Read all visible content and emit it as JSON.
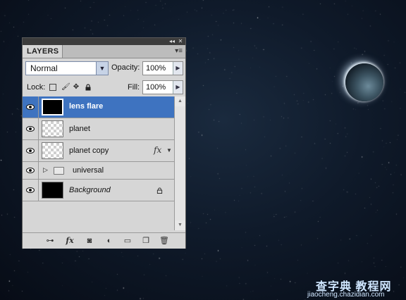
{
  "panel": {
    "collapse_icon": "double-left-arrow-icon",
    "close_icon": "close-icon",
    "tab_label": "LAYERS",
    "menu_icon": "panel-menu-icon"
  },
  "blend_mode": {
    "value": "Normal"
  },
  "opacity": {
    "label": "Opacity:",
    "value": "100%"
  },
  "lock": {
    "label": "Lock:",
    "icons": [
      "lock-transparent-pixels-icon",
      "lock-image-pixels-icon",
      "lock-position-icon",
      "lock-all-icon"
    ]
  },
  "fill": {
    "label": "Fill:",
    "value": "100%"
  },
  "layers": [
    {
      "name": "lens flare",
      "visible": true,
      "selected": true,
      "thumbnail": "black"
    },
    {
      "name": "planet",
      "visible": true,
      "selected": false,
      "thumbnail": "transparent"
    },
    {
      "name": "planet  copy",
      "visible": true,
      "selected": false,
      "thumbnail": "transparent",
      "effects": "fx"
    },
    {
      "name": "universal",
      "visible": true,
      "selected": false,
      "type": "group"
    },
    {
      "name": "Background",
      "visible": true,
      "selected": false,
      "thumbnail": "black",
      "locked": true
    }
  ],
  "footer_icons": [
    "link-layers-icon",
    "layer-style-icon",
    "layer-mask-icon",
    "adjustment-layer-icon",
    "new-group-icon",
    "new-layer-icon",
    "delete-layer-icon"
  ],
  "footer_fx": "fx",
  "watermark": {
    "main": "查字典 教程网",
    "sub": "jiaocheng.chazidian.com"
  },
  "colors": {
    "selection": "#3e73c0",
    "panel_bg": "#d6d6d6"
  }
}
